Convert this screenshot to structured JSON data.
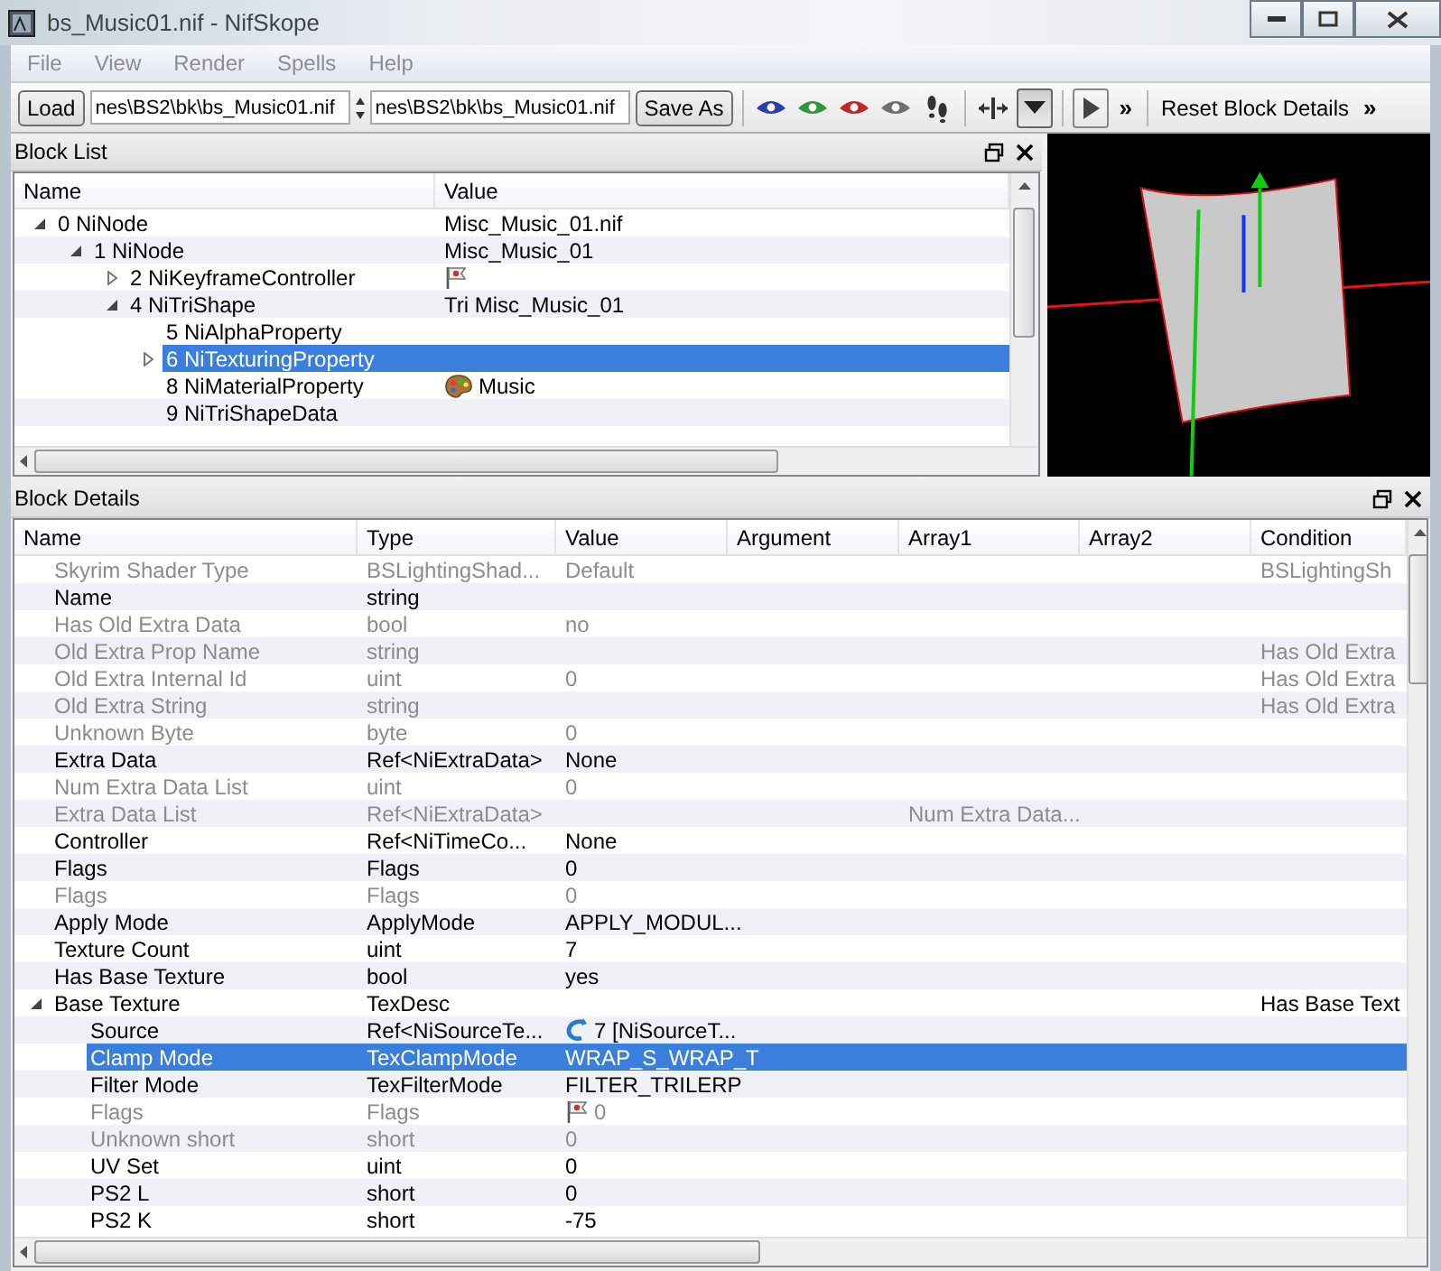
{
  "window": {
    "title": "bs_Music01.nif - NifSkope"
  },
  "menu": [
    "File",
    "View",
    "Render",
    "Spells",
    "Help"
  ],
  "toolbar": {
    "load": "Load",
    "path_fields": [
      {
        "value": "nes\\BS2\\bk\\bs_Music01.nif"
      },
      {
        "value": "nes\\BS2\\bk\\bs_Music01.nif"
      }
    ],
    "save_as": "Save As",
    "view_buttons": [
      {
        "kind": "eye",
        "color": "#2b3fa8",
        "pressed": false
      },
      {
        "kind": "eye",
        "color": "#2f9a3a",
        "pressed": false
      },
      {
        "kind": "eye",
        "color": "#c02828",
        "pressed": false
      },
      {
        "kind": "eye",
        "color": "#707070",
        "pressed": false
      },
      {
        "kind": "footprints",
        "pressed": false
      },
      {
        "kind": "axis",
        "pressed": false
      },
      {
        "kind": "dropdown",
        "pressed": true
      }
    ],
    "play": {
      "pressed": false
    },
    "overflow_1": "»",
    "reset": "Reset Block Details",
    "overflow_2": "»"
  },
  "block_list": {
    "title": "Block List",
    "columns": [
      "Name",
      "Value"
    ],
    "rows": [
      {
        "name": "0 NiNode",
        "value": "Misc_Music_01.nif",
        "selected": false,
        "expanded": true,
        "children": [
          {
            "name": "1 NiNode",
            "value": "Misc_Music_01",
            "selected": false,
            "expanded": true,
            "children": [
              {
                "name": "2 NiKeyframeController",
                "kind": "flag",
                "selected": false,
                "expanded": false
              },
              {
                "name": "4 NiTriShape",
                "value": "Tri Misc_Music_01",
                "selected": false,
                "expanded": true,
                "children": [
                  {
                    "name": "5 NiAlphaProperty",
                    "selected": false
                  },
                  {
                    "name": "6 NiTexturingProperty",
                    "selected": true,
                    "expanded": false
                  },
                  {
                    "name": "8 NiMaterialProperty",
                    "kind": "palette",
                    "value": "Music",
                    "selected": false
                  },
                  {
                    "name": "9 NiTriShapeData",
                    "selected": false
                  }
                ]
              }
            ]
          }
        ]
      }
    ]
  },
  "block_details": {
    "title": "Block Details",
    "columns": [
      "Name",
      "Type",
      "Value",
      "Argument",
      "Array1",
      "Array2",
      "Condition"
    ],
    "rows": [
      {
        "name": "Skyrim Shader Type",
        "type": "BSLightingShad...",
        "value": "Default",
        "condition": "BSLightingSh",
        "disabled": true,
        "selected": false
      },
      {
        "name": "Name",
        "type": "string",
        "disabled": false,
        "selected": false
      },
      {
        "name": "Has Old Extra Data",
        "type": "bool",
        "value": "no",
        "disabled": true,
        "selected": false
      },
      {
        "name": "Old Extra Prop Name",
        "type": "string",
        "condition": "Has Old Extra",
        "disabled": true,
        "selected": false
      },
      {
        "name": "Old Extra Internal Id",
        "type": "uint",
        "value": "0",
        "condition": "Has Old Extra",
        "disabled": true,
        "selected": false
      },
      {
        "name": "Old Extra String",
        "type": "string",
        "condition": "Has Old Extra",
        "disabled": true,
        "selected": false
      },
      {
        "name": "Unknown Byte",
        "type": "byte",
        "value": "0",
        "disabled": true,
        "selected": false
      },
      {
        "name": "Extra Data",
        "type": "Ref<NiExtraData>",
        "value": "None",
        "disabled": false,
        "selected": false
      },
      {
        "name": "Num Extra Data List",
        "type": "uint",
        "value": "0",
        "disabled": true,
        "selected": false
      },
      {
        "name": "Extra Data List",
        "type": "Ref<NiExtraData>",
        "array1": "Num Extra Data...",
        "disabled": true,
        "selected": false
      },
      {
        "name": "Controller",
        "type": "Ref<NiTimeCo...",
        "value": "None",
        "disabled": false,
        "selected": false
      },
      {
        "name": "Flags",
        "type": "Flags",
        "value": "0",
        "disabled": false,
        "selected": false
      },
      {
        "name": "Flags",
        "type": "Flags",
        "value": "0",
        "disabled": true,
        "selected": false
      },
      {
        "name": "Apply Mode",
        "type": "ApplyMode",
        "value": "APPLY_MODUL...",
        "disabled": false,
        "selected": false
      },
      {
        "name": "Texture Count",
        "type": "uint",
        "value": "7",
        "disabled": false,
        "selected": false
      },
      {
        "name": "Has Base Texture",
        "type": "bool",
        "value": "yes",
        "disabled": false,
        "selected": false
      },
      {
        "name": "Base Texture",
        "type": "TexDesc",
        "condition": "Has Base Text",
        "disabled": false,
        "selected": false,
        "expanded": true,
        "children": [
          {
            "name": "Source",
            "type": "Ref<NiSourceTe...",
            "kind": "link",
            "value": "7 [NiSourceT...",
            "disabled": false,
            "selected": false
          },
          {
            "name": "Clamp Mode",
            "type": "TexClampMode",
            "value": "WRAP_S_WRAP_T",
            "disabled": false,
            "selected": true
          },
          {
            "name": "Filter Mode",
            "type": "TexFilterMode",
            "value": "FILTER_TRILERP",
            "disabled": false,
            "selected": false
          },
          {
            "name": "Flags",
            "type": "Flags",
            "kind": "flag",
            "value": "0",
            "disabled": true,
            "selected": false
          },
          {
            "name": "Unknown short",
            "type": "short",
            "value": "0",
            "disabled": true,
            "selected": false
          },
          {
            "name": "UV Set",
            "type": "uint",
            "value": "0",
            "disabled": false,
            "selected": false
          },
          {
            "name": "PS2 L",
            "type": "short",
            "value": "0",
            "disabled": false,
            "selected": false
          },
          {
            "name": "PS2 K",
            "type": "short",
            "value": "-75",
            "disabled": false,
            "selected": false
          }
        ]
      }
    ]
  }
}
